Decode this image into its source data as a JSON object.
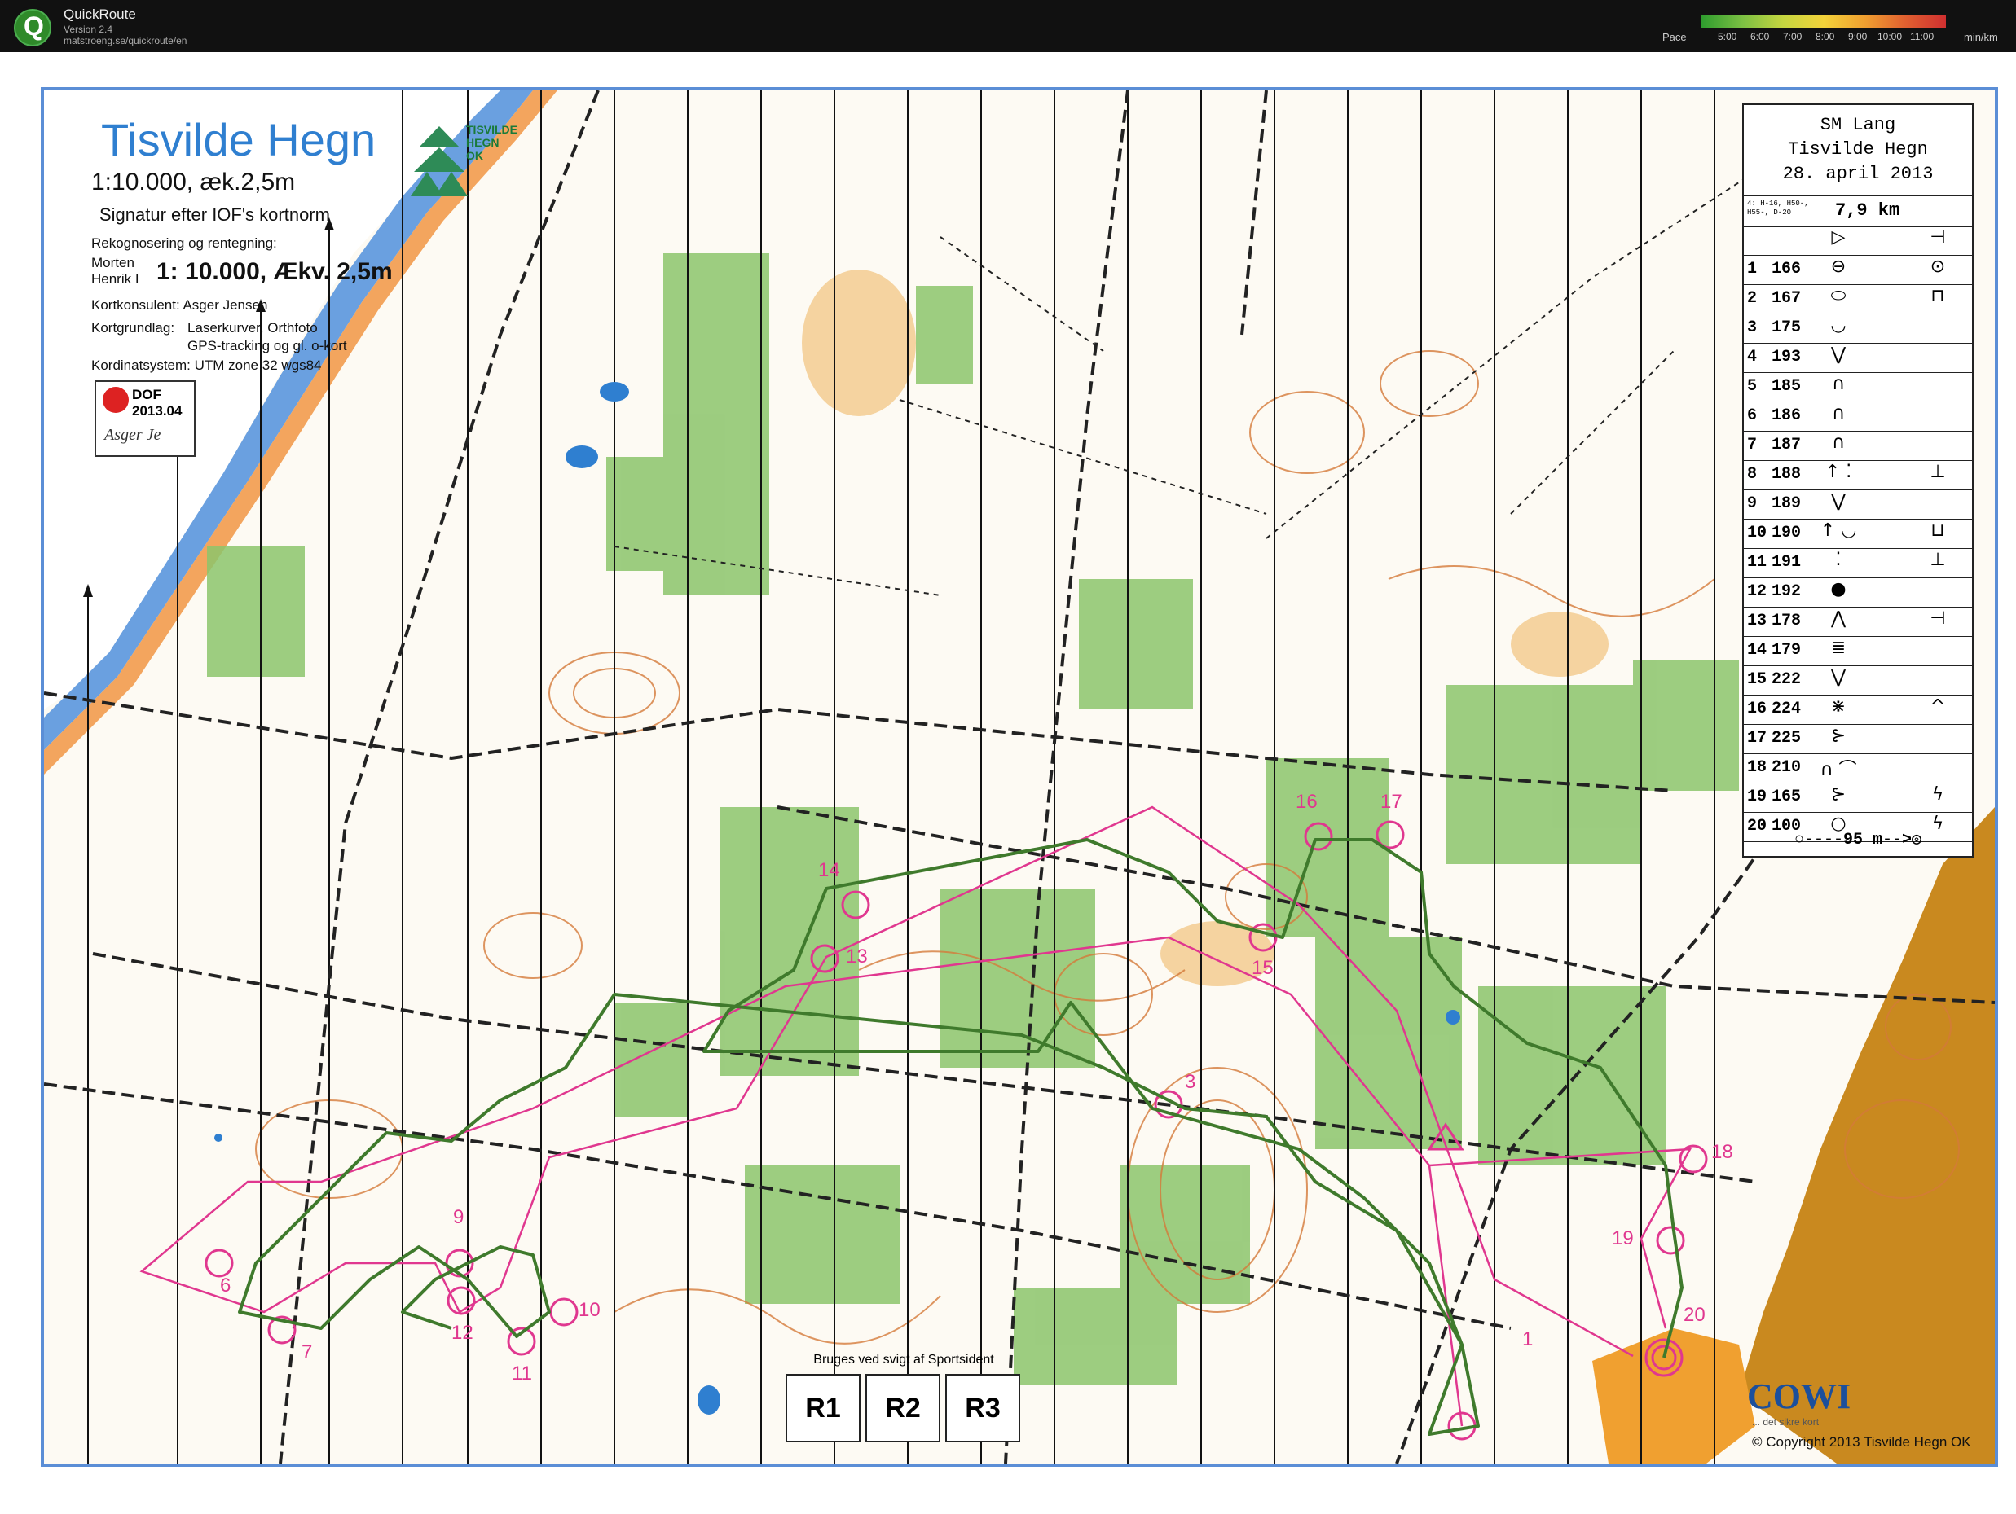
{
  "app": {
    "name": "QuickRoute",
    "version": "Version 2.4",
    "url": "matstroeng.se/quickroute/en"
  },
  "pace_legend": {
    "label": "Pace",
    "ticks": [
      "5:00",
      "6:00",
      "7:00",
      "8:00",
      "9:00",
      "10:00",
      "11:00"
    ],
    "unit": "min/km"
  },
  "map": {
    "title": "Tisvilde Hegn",
    "scale_line": "1:10.000,  æk.2,5m",
    "norm_line": "Signatur efter IOF's kortnorm",
    "recon_label": "Rekognosering og rentegning:",
    "recon_names": [
      "Morten",
      "Henrik I"
    ],
    "big_scale": "1: 10.000, Ækv. 2,5m",
    "consultant": "Kortkonsulent: Asger Jensen",
    "basis_label": "Kortgrundlag:",
    "basis_lines": [
      "Laserkurver, Orthfoto",
      "GPS-tracking og gl. o-kort"
    ],
    "coords": "Kordinatsystem: UTM zone 32 wgs84",
    "dof_text": "DOF",
    "dof_year": "2013.04",
    "dof_signature": "Asger Je",
    "club_name": [
      "TISVILDE",
      "HEGN OK"
    ],
    "print_note": "Bruges ved svigt af Sportsident",
    "print_boxes": [
      "R1",
      "R2",
      "R3"
    ],
    "sponsor": "COWI",
    "sponsor_tagline": "... det sikre kort",
    "copyright": "Copyright 2013 Tisvilde Hegn OK",
    "colors": {
      "frame": "#5b8ed6",
      "course": "#e0378f",
      "route": "#3f7a2c",
      "vegetation": "#8cc46b",
      "open_land": "#f3c98b",
      "contour": "#d47a3a",
      "water": "#6aa0e0",
      "path": "#222222"
    }
  },
  "control_descriptions": {
    "event": "SM Lang",
    "venue": "Tisvilde Hegn",
    "date": "28. april 2013",
    "classes": "4: H-16, H50-, H55-, D-20",
    "length": "7,9 km",
    "rows": [
      {
        "n": "",
        "code": "",
        "d": "▷",
        "x": "⊣"
      },
      {
        "n": "1",
        "code": "166",
        "d": "⊖",
        "x": "⊙"
      },
      {
        "n": "2",
        "code": "167",
        "d": "⬭",
        "x": "⊓"
      },
      {
        "n": "3",
        "code": "175",
        "d": "◡",
        "x": ""
      },
      {
        "n": "4",
        "code": "193",
        "d": "⋁",
        "x": ""
      },
      {
        "n": "5",
        "code": "185",
        "d": "∩",
        "x": ""
      },
      {
        "n": "6",
        "code": "186",
        "d": "∩",
        "x": ""
      },
      {
        "n": "7",
        "code": "187",
        "d": "∩",
        "x": ""
      },
      {
        "n": "8",
        "code": "188",
        "d": "↑ ⁚",
        "x": "⊥"
      },
      {
        "n": "9",
        "code": "189",
        "d": "⋁",
        "x": ""
      },
      {
        "n": "10",
        "code": "190",
        "d": "↑ ◡",
        "x": "⊔"
      },
      {
        "n": "11",
        "code": "191",
        "d": "⁚",
        "x": "⊥"
      },
      {
        "n": "12",
        "code": "192",
        "d": "●",
        "x": ""
      },
      {
        "n": "13",
        "code": "178",
        "d": "⋀",
        "x": "⊣"
      },
      {
        "n": "14",
        "code": "179",
        "d": "≣",
        "x": ""
      },
      {
        "n": "15",
        "code": "222",
        "d": "⋁",
        "x": ""
      },
      {
        "n": "16",
        "code": "224",
        "d": "⋇",
        "x": "^"
      },
      {
        "n": "17",
        "code": "225",
        "d": "⊱",
        "x": ""
      },
      {
        "n": "18",
        "code": "210",
        "d": "∩ ⌒",
        "x": ""
      },
      {
        "n": "19",
        "code": "165",
        "d": "⊱",
        "x": "ϟ"
      },
      {
        "n": "20",
        "code": "100",
        "d": "○",
        "x": "ϟ"
      }
    ],
    "finish": "○----95 m-->◎"
  },
  "course_labels": [
    "1",
    "3",
    "6",
    "7",
    "9",
    "10",
    "11",
    "12",
    "13",
    "14",
    "15",
    "16",
    "17",
    "18",
    "19",
    "20"
  ]
}
